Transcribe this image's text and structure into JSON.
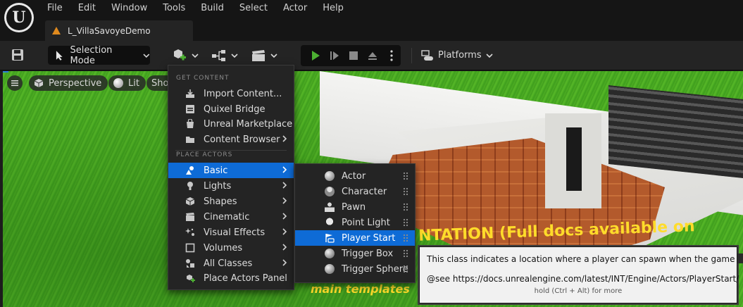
{
  "app": {
    "logo_glyph": "U",
    "menu": [
      "File",
      "Edit",
      "Window",
      "Tools",
      "Build",
      "Select",
      "Actor",
      "Help"
    ],
    "level_tab": "L_VillaSavoyeDemo"
  },
  "toolbar": {
    "selection_mode": "Selection Mode",
    "platforms": "Platforms"
  },
  "viewport": {
    "perspective": "Perspective",
    "lit": "Lit",
    "show_partial": "Sho",
    "overlay_text_1": "NTATION (Full docs available on",
    "overlay_text_2": "main templates"
  },
  "place_menu": {
    "section_get_content": "GET CONTENT",
    "section_place_actors": "PLACE ACTORS",
    "get_content": [
      {
        "label": "Import Content...",
        "icon": "import-icon",
        "submenu": false
      },
      {
        "label": "Quixel Bridge",
        "icon": "bridge-icon",
        "submenu": false
      },
      {
        "label": "Unreal Marketplace",
        "icon": "marketplace-icon",
        "submenu": false
      },
      {
        "label": "Content Browser",
        "icon": "folder-icon",
        "submenu": true
      }
    ],
    "place_actors": [
      {
        "label": "Basic",
        "icon": "basic-shapes-icon",
        "submenu": true,
        "active": true
      },
      {
        "label": "Lights",
        "icon": "light-bulb-icon",
        "submenu": true
      },
      {
        "label": "Shapes",
        "icon": "cube-icon",
        "submenu": true
      },
      {
        "label": "Cinematic",
        "icon": "clapper-icon",
        "submenu": true
      },
      {
        "label": "Visual Effects",
        "icon": "sparkle-icon",
        "submenu": true
      },
      {
        "label": "Volumes",
        "icon": "volume-icon",
        "submenu": true
      },
      {
        "label": "All Classes",
        "icon": "classes-icon",
        "submenu": true
      },
      {
        "label": "Place Actors Panel",
        "icon": "place-actors-icon",
        "submenu": false
      }
    ]
  },
  "basic_submenu": [
    {
      "label": "Actor",
      "icon": "actor-sphere-icon"
    },
    {
      "label": "Character",
      "icon": "character-icon"
    },
    {
      "label": "Pawn",
      "icon": "pawn-icon"
    },
    {
      "label": "Point Light",
      "icon": "point-light-icon"
    },
    {
      "label": "Player Start",
      "icon": "player-start-icon",
      "active": true
    },
    {
      "label": "Trigger Box",
      "icon": "trigger-box-icon"
    },
    {
      "label": "Trigger Sphere",
      "icon": "trigger-sphere-icon"
    }
  ],
  "tooltip": {
    "description": "This class indicates a location where a player can spawn when the game begins",
    "see": "@see https://docs.unrealengine.com/latest/INT/Engine/Actors/PlayerStart/",
    "hint": "hold (Ctrl + Alt) for more"
  },
  "colors": {
    "accent": "#0e6bd6",
    "play_green": "#4caf32",
    "level_icon": "#e08a1e",
    "overlay_text": "#ffdc2a"
  }
}
